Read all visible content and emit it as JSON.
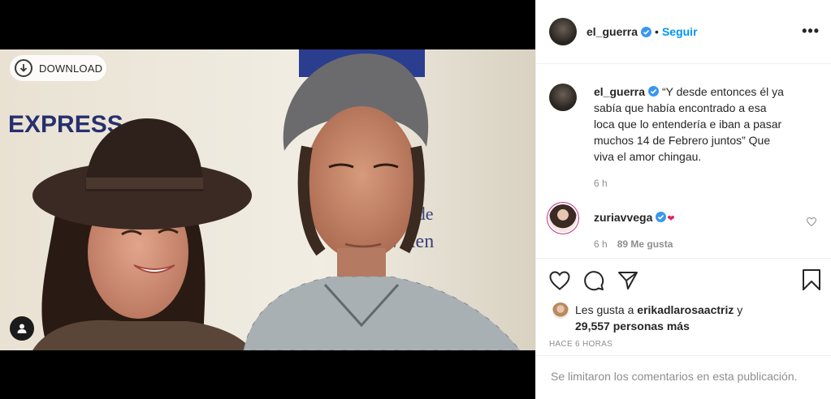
{
  "media": {
    "download_label": "DOWNLOAD",
    "icons": {
      "download": "download-arrow-icon",
      "tag": "user-tag-icon"
    },
    "backdrop_text": {
      "express": "EXPRESS",
      "partial_line1": "U  ía de",
      "partial_line2": "W           llen"
    }
  },
  "header": {
    "username": "el_guerra",
    "separator": "•",
    "follow_label": "Seguir",
    "more_label": "•••"
  },
  "caption": {
    "username": "el_guerra",
    "text": "“Y desde entonces él ya sabía que había encontrado a esa loca que lo entendería e iban a pasar muchos 14 de Febrero juntos” Que viva el amor chingau.",
    "time": "6 h"
  },
  "comment": {
    "username": "zuriavvega",
    "emoji": "❤",
    "time": "6 h",
    "likes": "89 Me gusta"
  },
  "likes": {
    "prefix": "Les gusta a ",
    "user": "erikadlarosaactriz",
    "joiner": " y",
    "count": "29,557 personas más"
  },
  "timestamp": "HACE 6 HORAS",
  "footer_notice": "Se limitaron los comentarios en esta publicación.",
  "colors": {
    "link_blue": "#0095f6",
    "muted": "#8e8e8e",
    "text": "#262626",
    "verified_blue": "#3897f0"
  }
}
